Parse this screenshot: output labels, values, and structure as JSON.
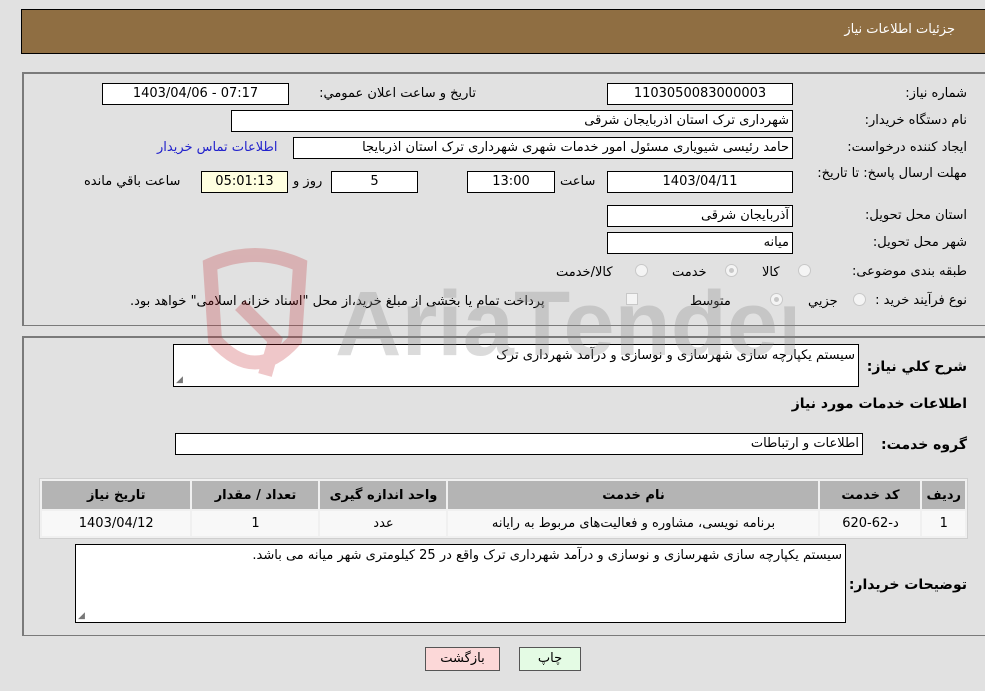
{
  "header": {
    "title": "جزئیات اطلاعات نیاز"
  },
  "form": {
    "need_number": {
      "label": "شماره نیاز:",
      "value": "1103050083000003"
    },
    "announce_datetime": {
      "label": "تاریخ و ساعت اعلان عمومي:",
      "value": "1403/04/06 - 07:17"
    },
    "buyer_org": {
      "label": "نام دستگاه خریدار:",
      "value": "شهرداری ترک استان اذربایجان شرقی"
    },
    "requester": {
      "label": "ایجاد کننده درخواست:",
      "value": "حامد رئیسی شیویاری مسئول امور خدمات شهری شهرداری ترک استان اذربایجا"
    },
    "buyer_contact_link": "اطلاعات تماس خریدار",
    "deadline": {
      "label": "مهلت ارسال پاسخ: تا تاریخ:",
      "date": "1403/04/11",
      "time_label": "ساعت",
      "time": "13:00",
      "days": "5",
      "days_label": "روز و",
      "remaining": "05:01:13",
      "remaining_label": "ساعت باقي مانده"
    },
    "delivery_province": {
      "label": "استان محل تحویل:",
      "value": "آذربایجان شرقی"
    },
    "delivery_city": {
      "label": "شهر محل تحویل:",
      "value": "میانه"
    },
    "category": {
      "label": "طبقه بندی موضوعی:",
      "options": [
        "کالا",
        "خدمت",
        "کالا/خدمت"
      ],
      "selected": "خدمت"
    },
    "purchase_type": {
      "label": "نوع فرآیند خرید :",
      "options": [
        "جزيي",
        "متوسط"
      ],
      "selected": "متوسط",
      "treasury_checkbox_label": "پرداخت تمام یا بخشی از مبلغ خرید،از محل \"اسناد خزانه اسلامی\" خواهد بود.",
      "treasury_checked": false
    }
  },
  "details": {
    "general_description": {
      "label": "شرح كلي نياز:",
      "value": "سیستم یکپارچه سازی شهرسازی و نوسازی و درآمد شهرداری ترک"
    },
    "services_heading": "اطلاعات خدمات مورد نیاز",
    "service_group": {
      "label": "گروه خدمت:",
      "value": "اطلاعات و ارتباطات"
    },
    "table": {
      "headers": [
        "ردیف",
        "کد خدمت",
        "نام خدمت",
        "واحد اندازه گیری",
        "تعداد / مقدار",
        "تاریخ نیاز"
      ],
      "rows": [
        [
          "1",
          "د-62-620",
          "برنامه نویسی، مشاوره و فعالیت‌های مربوط به رایانه",
          "عدد",
          "1",
          "1403/04/12"
        ]
      ]
    },
    "buyer_notes": {
      "label": "توضیحات خریدار:",
      "value": "سیستم یکپارچه سازی شهرسازی و نوسازی و درآمد شهرداری ترک واقع در 25 کیلومتری شهر میانه می باشد."
    }
  },
  "buttons": {
    "print": "چاپ",
    "back": "بازگشت"
  },
  "watermark": {
    "text": "AriaTender.neT"
  }
}
